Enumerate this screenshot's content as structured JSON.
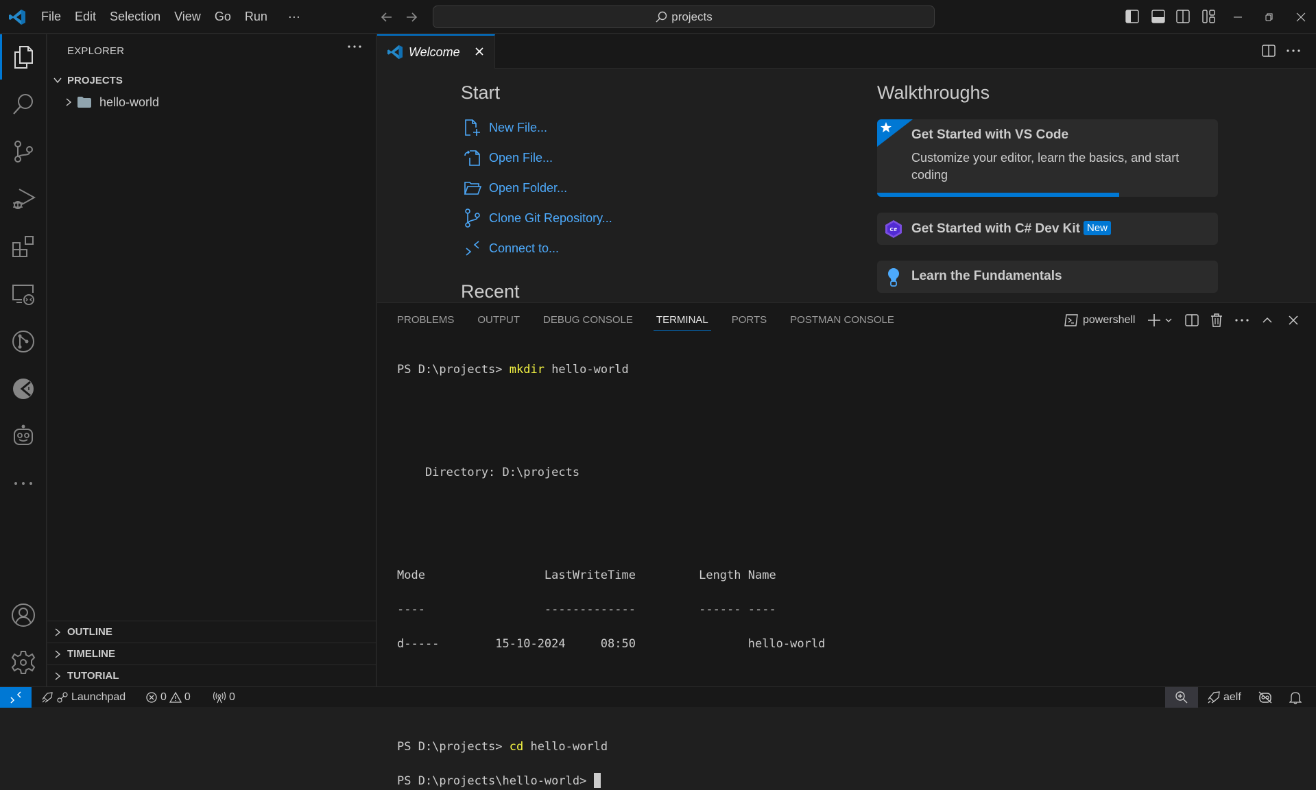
{
  "titlebar": {
    "menu": [
      "File",
      "Edit",
      "Selection",
      "View",
      "Go",
      "Run"
    ],
    "more_label": "···",
    "search_text": "projects",
    "icons": [
      "vscode-logo",
      "back-arrow",
      "forward-arrow",
      "toggle-primary-sidebar",
      "toggle-panel",
      "toggle-secondary-sidebar",
      "customize-layout",
      "minimize",
      "restore",
      "close"
    ]
  },
  "activitybar": {
    "items": [
      "explorer",
      "search",
      "source-control",
      "run-and-debug",
      "extensions",
      "remote-explorer",
      "gitlens",
      "postman",
      "copilot",
      "more"
    ],
    "bottom": [
      "accounts",
      "manage"
    ]
  },
  "sidebar": {
    "title": "EXPLORER",
    "folder": "PROJECTS",
    "tree": [
      {
        "name": "hello-world",
        "type": "folder",
        "expanded": false
      }
    ],
    "sections": [
      "OUTLINE",
      "TIMELINE",
      "TUTORIAL"
    ]
  },
  "editor": {
    "tabs": [
      {
        "label": "Welcome",
        "active": true
      }
    ]
  },
  "welcome": {
    "start_heading": "Start",
    "start_items": [
      {
        "label": "New File...",
        "icon": "new-file"
      },
      {
        "label": "Open File...",
        "icon": "open-file"
      },
      {
        "label": "Open Folder...",
        "icon": "open-folder"
      },
      {
        "label": "Clone Git Repository...",
        "icon": "git-branch"
      },
      {
        "label": "Connect to...",
        "icon": "remote"
      }
    ],
    "recent_heading": "Recent",
    "walkthroughs_heading": "Walkthroughs",
    "walkthroughs": [
      {
        "title": "Get Started with VS Code",
        "description": "Customize your editor, learn the basics, and start coding",
        "progress": 0.71,
        "featured": true
      },
      {
        "title": "Get Started with C# Dev Kit",
        "badge": "New",
        "icon": "csharp"
      },
      {
        "title": "Learn the Fundamentals",
        "icon": "lightbulb"
      }
    ]
  },
  "panel": {
    "tabs": [
      "PROBLEMS",
      "OUTPUT",
      "DEBUG CONSOLE",
      "TERMINAL",
      "PORTS",
      "POSTMAN CONSOLE"
    ],
    "active_tab": "TERMINAL",
    "terminal_name": "powershell",
    "terminal": {
      "line1_prompt": "PS D:\\projects> ",
      "line1_cmd": "mkdir",
      "line1_arg": " hello-world",
      "directory": "    Directory: D:\\projects",
      "header": "Mode                 LastWriteTime         Length Name",
      "divider": "----                 -------------         ------ ----",
      "row": "d-----        15-10-2024     08:50                hello-world",
      "line2_prompt": "PS D:\\projects> ",
      "line2_cmd": "cd",
      "line2_arg": " hello-world",
      "line3_prompt": "PS D:\\projects\\hello-world> "
    }
  },
  "statusbar": {
    "launchpad": "Launchpad",
    "errors": "0",
    "warnings": "0",
    "ports": "0",
    "account": "aelf"
  },
  "colors": {
    "accent": "#0078d4",
    "link": "#4daafc",
    "command": "#f5f543"
  }
}
